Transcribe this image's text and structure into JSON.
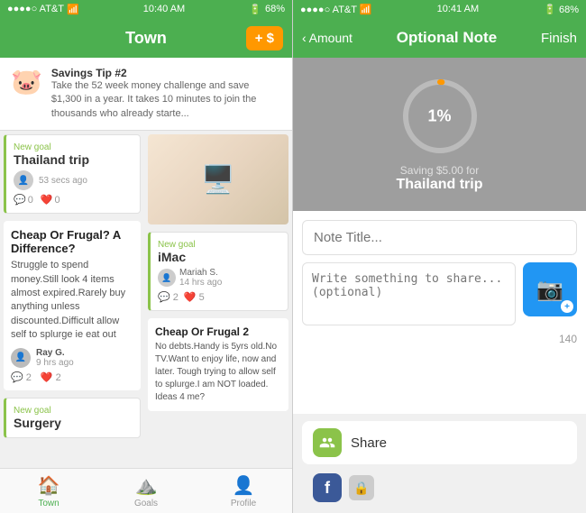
{
  "left": {
    "status_bar": {
      "carrier": "●●●●○ AT&T",
      "time": "10:40 AM",
      "battery": "68%"
    },
    "header": {
      "title": "Town",
      "add_button": "+ $"
    },
    "savings_tip": {
      "title": "Savings Tip #2",
      "text": "Take the 52 week money challenge and save $1,300 in a year. It takes 10 minutes to join the thousands who already starte...",
      "icon": "🐷"
    },
    "goal_thailand": {
      "new_goal_label": "New goal",
      "title": "Thailand trip",
      "time": "53 secs ago",
      "comments": "0",
      "likes": "0"
    },
    "article": {
      "title": "Cheap Or Frugal? A Difference?",
      "text": "Struggle to spend money.Still look 4 items almost expired.Rarely buy anything unless discounted.Difficult allow self to splurge ie eat out",
      "author": "Ray G.",
      "time": "9 hrs ago",
      "comments": "2",
      "likes": "2"
    },
    "goal_imac": {
      "new_goal_label": "New goal",
      "title": "iMac",
      "user": "Mariah S.",
      "time": "14 hrs ago",
      "comments": "2",
      "likes": "5"
    },
    "article_frugal2": {
      "title": "Cheap Or Frugal 2",
      "text": "No debts.Handy is 5yrs old.No TV.Want to enjoy life, now and later. Tough trying to allow self to splurge.I am NOT loaded. Ideas 4 me?"
    },
    "goal_surgery": {
      "new_goal_label": "New goal",
      "title": "Surgery"
    },
    "tabs": [
      {
        "label": "Town",
        "icon": "🏠",
        "active": true
      },
      {
        "label": "Goals",
        "icon": "⛰️",
        "active": false
      },
      {
        "label": "Profile",
        "icon": "👤",
        "active": false
      }
    ]
  },
  "right": {
    "status_bar": {
      "carrier": "●●●●○ AT&T",
      "time": "10:41 AM",
      "battery": "68%"
    },
    "header": {
      "back_label": "Amount",
      "title": "Optional Note",
      "finish_label": "Finish"
    },
    "progress": {
      "percent": "1%",
      "percent_value": 1,
      "saving_for": "Saving $5.00 for",
      "goal_name": "Thailand trip"
    },
    "note": {
      "title_placeholder": "Note Title...",
      "body_placeholder": "Write something to share... (optional)",
      "char_count": "140"
    },
    "share": {
      "label": "Share"
    }
  }
}
